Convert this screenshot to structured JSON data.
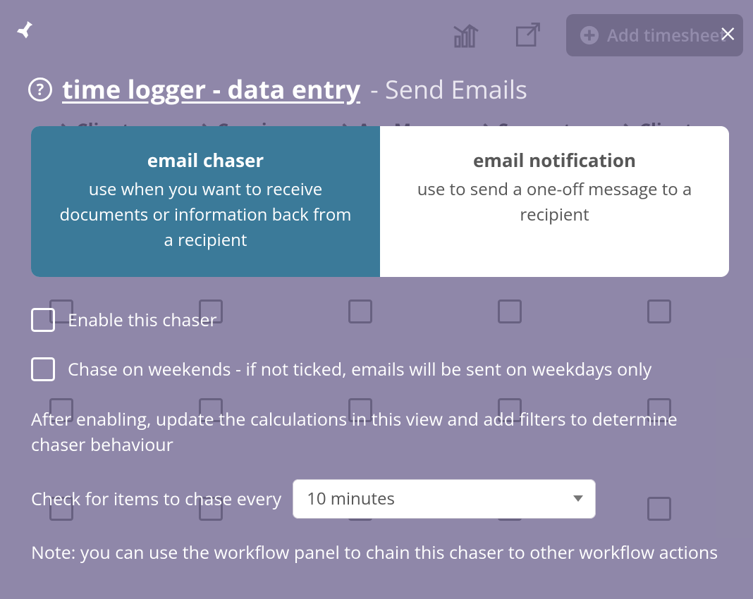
{
  "background": {
    "add_button_label": "Add timesheet",
    "columns": [
      {
        "label": "Client Proje…"
      },
      {
        "label": "Concier Work"
      },
      {
        "label": "Acc Man…"
      },
      {
        "label": "Support Work"
      },
      {
        "label": "Client Proje…"
      }
    ]
  },
  "modal": {
    "title_main": "time logger - data entry",
    "title_suffix": "- Send Emails",
    "tabs": [
      {
        "title": "email chaser",
        "description": "use when you want to receive documents or information back from a recipient",
        "active": true
      },
      {
        "title": "email notification",
        "description": "use to send a one-off message to a recipient",
        "active": false
      }
    ],
    "checkbox_enable_label": "Enable this chaser",
    "checkbox_weekends_label": "Chase on weekends - if not ticked, emails will be sent on weekdays only",
    "info_after_enable": "After enabling, update the calculations in this view and add filters to determine chaser behaviour",
    "interval_label": "Check for items to chase every",
    "interval_value": "10 minutes",
    "note_workflow": "Note: you can use the workflow panel to chain this chaser to other workflow actions"
  }
}
